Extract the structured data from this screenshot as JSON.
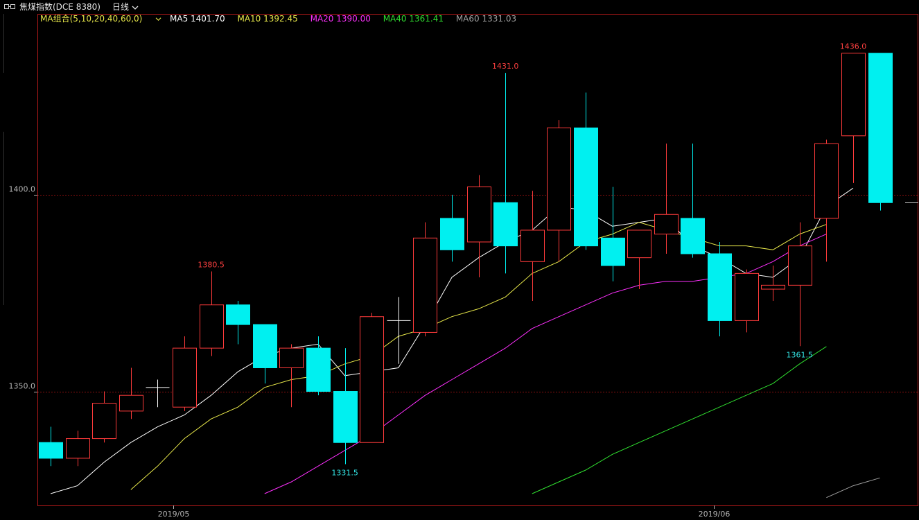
{
  "header": {
    "icon": "link-icon",
    "title": "焦煤指数(DCE 8380)",
    "period": "日线"
  },
  "ma_legend": {
    "group": "MA组合(5,10,20,40,60,0)",
    "ma5": "MA5 1401.70",
    "ma10": "MA10 1392.45",
    "ma20": "MA20 1390.00",
    "ma40": "MA40 1361.41",
    "ma60": "MA60 1331.03"
  },
  "colors": {
    "up": "#ff3b3b",
    "down": "#00f0f0",
    "frame": "#b31a1a",
    "grid": "#8a1010",
    "ma5": "#ffffff",
    "ma10": "#e8e84a",
    "ma20": "#ff30ff",
    "ma40": "#30e030",
    "ma60": "#a0a0a0",
    "ann_high": "#ff4040",
    "ann_low": "#33e5e5"
  },
  "chart_data": {
    "type": "candlestick",
    "instrument": "焦煤指数(DCE 8380)",
    "period": "日线",
    "ylim": [
      1321,
      1446
    ],
    "y_ticks": [
      "1350.0",
      "1400.0"
    ],
    "x_tick_labels": [
      "2019/05",
      "2019/06"
    ],
    "x_tick_index": [
      4,
      24
    ],
    "candles": [
      {
        "o": 1337,
        "h": 1341,
        "l": 1331,
        "c": 1333
      },
      {
        "o": 1333,
        "h": 1340,
        "l": 1331,
        "c": 1338
      },
      {
        "o": 1338,
        "h": 1350,
        "l": 1337,
        "c": 1347
      },
      {
        "o": 1345,
        "h": 1356,
        "l": 1343,
        "c": 1349
      },
      {
        "o": 1351,
        "h": 1353,
        "l": 1346,
        "c": 1351
      },
      {
        "o": 1346,
        "h": 1364,
        "l": 1345,
        "c": 1361
      },
      {
        "o": 1361,
        "h": 1380.5,
        "l": 1359,
        "c": 1372
      },
      {
        "o": 1372,
        "h": 1373,
        "l": 1362,
        "c": 1367
      },
      {
        "o": 1367,
        "h": 1367,
        "l": 1352,
        "c": 1356
      },
      {
        "o": 1356,
        "h": 1362,
        "l": 1346,
        "c": 1361
      },
      {
        "o": 1361,
        "h": 1364,
        "l": 1349,
        "c": 1350
      },
      {
        "o": 1350,
        "h": 1361,
        "l": 1331.5,
        "c": 1337
      },
      {
        "o": 1337,
        "h": 1370,
        "l": 1337,
        "c": 1369
      },
      {
        "o": 1368,
        "h": 1374,
        "l": 1357,
        "c": 1368
      },
      {
        "o": 1365,
        "h": 1393,
        "l": 1364,
        "c": 1389
      },
      {
        "o": 1394,
        "h": 1400,
        "l": 1383,
        "c": 1386
      },
      {
        "o": 1388,
        "h": 1405,
        "l": 1379,
        "c": 1402
      },
      {
        "o": 1398,
        "h": 1431.0,
        "l": 1380,
        "c": 1387
      },
      {
        "o": 1383,
        "h": 1401,
        "l": 1373,
        "c": 1391
      },
      {
        "o": 1391,
        "h": 1419,
        "l": 1383,
        "c": 1417
      },
      {
        "o": 1417,
        "h": 1426,
        "l": 1386,
        "c": 1387
      },
      {
        "o": 1389,
        "h": 1402,
        "l": 1378,
        "c": 1382
      },
      {
        "o": 1384,
        "h": 1391,
        "l": 1376,
        "c": 1391
      },
      {
        "o": 1390,
        "h": 1413,
        "l": 1385,
        "c": 1395
      },
      {
        "o": 1394,
        "h": 1413,
        "l": 1384,
        "c": 1385
      },
      {
        "o": 1385,
        "h": 1388,
        "l": 1364,
        "c": 1368
      },
      {
        "o": 1368,
        "h": 1381,
        "l": 1365,
        "c": 1380
      },
      {
        "o": 1376,
        "h": 1382,
        "l": 1373,
        "c": 1377
      },
      {
        "o": 1377,
        "h": 1393,
        "l": 1361.5,
        "c": 1387
      },
      {
        "o": 1394,
        "h": 1414,
        "l": 1383,
        "c": 1413
      },
      {
        "o": 1415,
        "h": 1435,
        "l": 1403,
        "c": 1436
      },
      {
        "o": 1436,
        "h": 1436,
        "l": 1396,
        "c": 1398
      }
    ],
    "last_price": 1398,
    "annotations": [
      {
        "text": "1380.5",
        "index": 6,
        "value": 1380.5,
        "kind": "high"
      },
      {
        "text": "1331.5",
        "index": 11,
        "value": 1331.5,
        "kind": "low"
      },
      {
        "text": "1431.0",
        "index": 17,
        "value": 1431.0,
        "kind": "high"
      },
      {
        "text": "1361.5",
        "index": 28,
        "value": 1361.5,
        "kind": "low"
      },
      {
        "text": "1436.0",
        "index": 30,
        "value": 1436.0,
        "kind": "high"
      }
    ],
    "series": [
      {
        "name": "MA5",
        "start": 0,
        "values": [
          1324,
          1326,
          1332,
          1337,
          1341,
          1344,
          1349,
          1355,
          1359,
          1361,
          1362,
          1354,
          1355,
          1356,
          1367,
          1379,
          1384,
          1388,
          1391,
          1397,
          1396,
          1392,
          1393,
          1394,
          1387,
          1384,
          1380,
          1379,
          1384,
          1397,
          1401.7
        ]
      },
      {
        "name": "MA10",
        "start": 3,
        "values": [
          1325,
          1331,
          1338,
          1343,
          1346,
          1351,
          1353,
          1354,
          1357,
          1359,
          1364,
          1366,
          1369,
          1371,
          1374,
          1380,
          1383,
          1388,
          1390,
          1393,
          1391,
          1389,
          1387,
          1387,
          1386,
          1390,
          1392.45
        ]
      },
      {
        "name": "MA20",
        "start": 8,
        "values": [
          1324,
          1327,
          1331,
          1335,
          1339,
          1344,
          1349,
          1353,
          1357,
          1361,
          1366,
          1369,
          1372,
          1375,
          1377,
          1378,
          1378,
          1379,
          1380,
          1383,
          1387,
          1390.0
        ]
      },
      {
        "name": "MA40",
        "start": 18,
        "values": [
          1324,
          1327,
          1330,
          1334,
          1337,
          1340,
          1343,
          1346,
          1349,
          1352,
          1357,
          1361.41
        ]
      },
      {
        "name": "MA60",
        "start": 29,
        "values": [
          1323,
          1326,
          1328
        ]
      }
    ]
  }
}
